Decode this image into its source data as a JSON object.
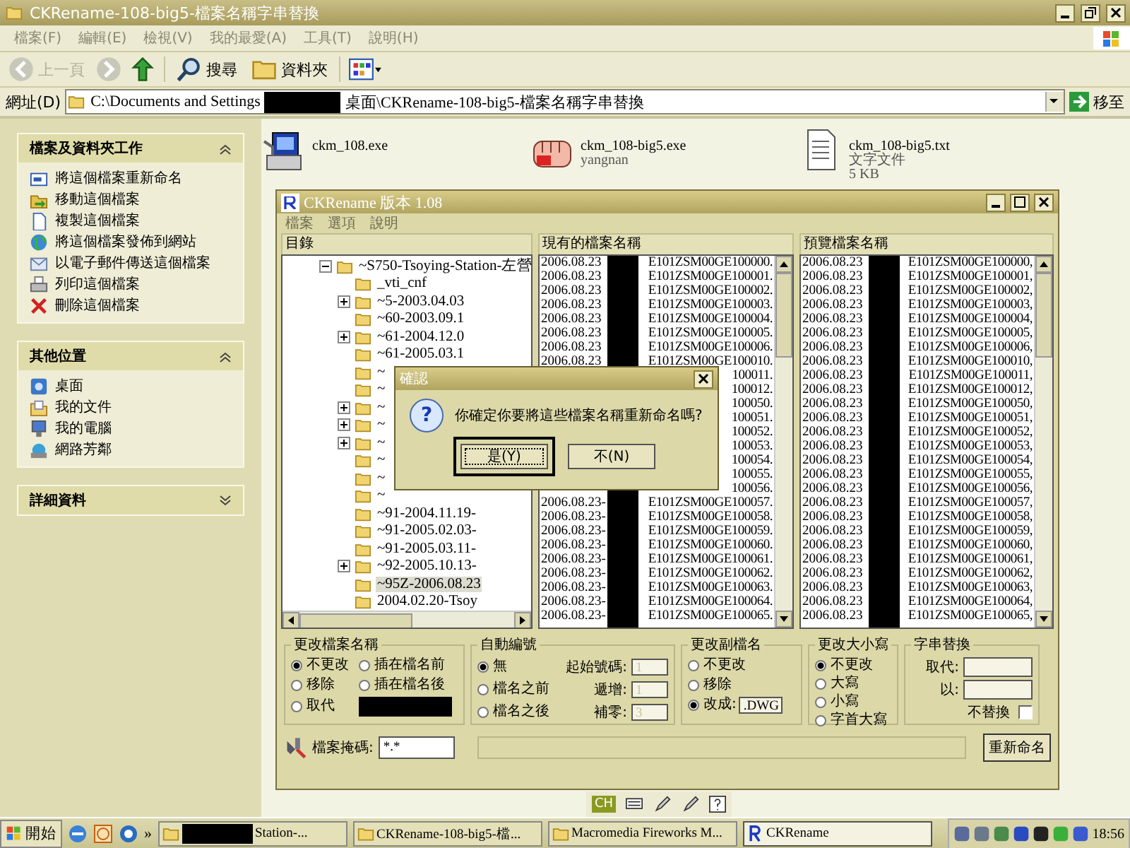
{
  "window": {
    "title": "CKRename-108-big5-檔案名稱字串替換"
  },
  "menu": [
    "檔案(F)",
    "編輯(E)",
    "檢視(V)",
    "我的最愛(A)",
    "工具(T)",
    "說明(H)"
  ],
  "toolbar": {
    "back": "上一頁",
    "search": "搜尋",
    "folders": "資料夾"
  },
  "address": {
    "label": "網址(D)",
    "path_start": "C:\\Documents and Settings",
    "path_end": "桌面\\CKRename-108-big5-檔案名稱字串替換",
    "go": "移至"
  },
  "sidebar": [
    {
      "title": "檔案及資料夾工作",
      "expanded": true,
      "items": [
        "將這個檔案重新命名",
        "移動這個檔案",
        "複製這個檔案",
        "將這個檔案發佈到網站",
        "以電子郵件傳送這個檔案",
        "列印這個檔案",
        "刪除這個檔案"
      ]
    },
    {
      "title": "其他位置",
      "expanded": true,
      "items": [
        "桌面",
        "我的文件",
        "我的電腦",
        "網路芳鄰"
      ]
    },
    {
      "title": "詳細資料",
      "expanded": false
    }
  ],
  "files": [
    {
      "name": "ckm_108.exe"
    },
    {
      "name": "ckm_108-big5.exe",
      "details": [
        "yangnan"
      ]
    },
    {
      "name": "ckm_108-big5.txt",
      "details": [
        "文字文件",
        "5 KB"
      ]
    }
  ],
  "app": {
    "title": "CKRename 版本 1.08",
    "menu": [
      "檔案",
      "選項",
      "說明"
    ],
    "tree": {
      "heading": "目錄",
      "items": [
        {
          "label": "~S750-Tsoying-Station-左營",
          "expander": true,
          "expanded": true,
          "selected": false,
          "children": [
            {
              "label": "_vti_cnf",
              "expander": false,
              "selected": false
            },
            {
              "label": "~5-2003.04.03",
              "expander": true,
              "selected": false
            },
            {
              "label": "~60-2003.09.1",
              "expander": false,
              "selected": false
            },
            {
              "label": "~61-2004.12.0",
              "expander": true,
              "selected": false
            },
            {
              "label": "~61-2005.03.1",
              "expander": false,
              "selected": false
            },
            {
              "label": "~",
              "expander": false,
              "selected": false
            },
            {
              "label": "~",
              "expander": false,
              "selected": false
            },
            {
              "label": "~",
              "expander": true,
              "selected": false
            },
            {
              "label": "~",
              "expander": true,
              "selected": false
            },
            {
              "label": "~",
              "expander": true,
              "selected": false
            },
            {
              "label": "~",
              "expander": false,
              "selected": false
            },
            {
              "label": "~",
              "expander": false,
              "selected": false
            },
            {
              "label": "~",
              "expander": false,
              "selected": false
            },
            {
              "label": "~91-2004.11.19-",
              "expander": false,
              "selected": false
            },
            {
              "label": "~91-2005.02.03-",
              "expander": false,
              "selected": false
            },
            {
              "label": "~91-2005.03.11-",
              "expander": false,
              "selected": false
            },
            {
              "label": "~92-2005.10.13-",
              "expander": true,
              "selected": false
            },
            {
              "label": "~95Z-2006.08.23",
              "expander": false,
              "selected": true
            },
            {
              "label": "2004.02.20-Tsoy",
              "expander": false,
              "selected": false
            }
          ]
        }
      ]
    },
    "current": {
      "heading": "現有的檔案名稱",
      "rows": [
        {
          "prefix": "2006.08.23",
          "suffix": "E101ZSM00GE100000."
        },
        {
          "prefix": "2006.08.23",
          "suffix": "E101ZSM00GE100001."
        },
        {
          "prefix": "2006.08.23",
          "suffix": "E101ZSM00GE100002."
        },
        {
          "prefix": "2006.08.23",
          "suffix": "E101ZSM00GE100003."
        },
        {
          "prefix": "2006.08.23",
          "suffix": "E101ZSM00GE100004."
        },
        {
          "prefix": "2006.08.23",
          "suffix": "E101ZSM00GE100005."
        },
        {
          "prefix": "2006.08.23",
          "suffix": "E101ZSM00GE100006."
        },
        {
          "prefix": "2006.08.23",
          "suffix": "E101ZSM00GE100010."
        },
        {
          "suffix": "100011."
        },
        {
          "suffix": "100012."
        },
        {
          "suffix": "100050."
        },
        {
          "suffix": "100051."
        },
        {
          "suffix": "100052."
        },
        {
          "suffix": "100053."
        },
        {
          "suffix": "100054."
        },
        {
          "suffix": "100055."
        },
        {
          "suffix": "100056."
        },
        {
          "prefix": "2006.08.23-",
          "suffix": "E101ZSM00GE100057."
        },
        {
          "prefix": "2006.08.23-",
          "suffix": "E101ZSM00GE100058."
        },
        {
          "prefix": "2006.08.23-",
          "suffix": "E101ZSM00GE100059."
        },
        {
          "prefix": "2006.08.23-",
          "suffix": "E101ZSM00GE100060."
        },
        {
          "prefix": "2006.08.23-",
          "suffix": "E101ZSM00GE100061."
        },
        {
          "prefix": "2006.08.23-",
          "suffix": "E101ZSM00GE100062."
        },
        {
          "prefix": "2006.08.23-",
          "suffix": "E101ZSM00GE100063."
        },
        {
          "prefix": "2006.08.23-",
          "suffix": "E101ZSM00GE100064."
        },
        {
          "prefix": "2006.08.23-",
          "suffix": "E101ZSM00GE100065."
        }
      ]
    },
    "preview": {
      "heading": "預覽檔案名稱",
      "rows": [
        {
          "prefix": "2006.08.23",
          "suffix": "E101ZSM00GE100000,"
        },
        {
          "prefix": "2006.08.23",
          "suffix": "E101ZSM00GE100001,"
        },
        {
          "prefix": "2006.08.23",
          "suffix": "E101ZSM00GE100002,"
        },
        {
          "prefix": "2006.08.23",
          "suffix": "E101ZSM00GE100003,"
        },
        {
          "prefix": "2006.08.23",
          "suffix": "E101ZSM00GE100004,"
        },
        {
          "prefix": "2006.08.23",
          "suffix": "E101ZSM00GE100005,"
        },
        {
          "prefix": "2006.08.23",
          "suffix": "E101ZSM00GE100006,"
        },
        {
          "prefix": "2006.08.23",
          "suffix": "E101ZSM00GE100010,"
        },
        {
          "prefix": "2006.08.23",
          "suffix": "E101ZSM00GE100011,"
        },
        {
          "prefix": "2006.08.23",
          "suffix": "E101ZSM00GE100012,"
        },
        {
          "prefix": "2006.08.23",
          "suffix": "E101ZSM00GE100050,"
        },
        {
          "prefix": "2006.08.23",
          "suffix": "E101ZSM00GE100051,"
        },
        {
          "prefix": "2006.08.23",
          "suffix": "E101ZSM00GE100052,"
        },
        {
          "prefix": "2006.08.23",
          "suffix": "E101ZSM00GE100053,"
        },
        {
          "prefix": "2006.08.23",
          "suffix": "E101ZSM00GE100054,"
        },
        {
          "prefix": "2006.08.23",
          "suffix": "E101ZSM00GE100055,"
        },
        {
          "prefix": "2006.08.23",
          "suffix": "E101ZSM00GE100056,"
        },
        {
          "prefix": "2006.08.23",
          "suffix": "E101ZSM00GE100057,"
        },
        {
          "prefix": "2006.08.23",
          "suffix": "E101ZSM00GE100058,"
        },
        {
          "prefix": "2006.08.23",
          "suffix": "E101ZSM00GE100059,"
        },
        {
          "prefix": "2006.08.23",
          "suffix": "E101ZSM00GE100060,"
        },
        {
          "prefix": "2006.08.23",
          "suffix": "E101ZSM00GE100061,"
        },
        {
          "prefix": "2006.08.23",
          "suffix": "E101ZSM00GE100062,"
        },
        {
          "prefix": "2006.08.23",
          "suffix": "E101ZSM00GE100063,"
        },
        {
          "prefix": "2006.08.23",
          "suffix": "E101ZSM00GE100064,"
        },
        {
          "prefix": "2006.08.23",
          "suffix": "E101ZSM00GE100065,"
        }
      ]
    },
    "rename_group": {
      "title": "更改檔案名稱",
      "options": [
        {
          "label": "不更改",
          "selected": true
        },
        {
          "label": "插在檔名前",
          "selected": false
        },
        {
          "label": "移除",
          "selected": false
        },
        {
          "label": "插在檔名後",
          "selected": false
        },
        {
          "label": "取代",
          "selected": false
        }
      ]
    },
    "numbering": {
      "title": "自動編號",
      "options": [
        {
          "label": "無",
          "selected": true
        },
        {
          "label": "檔名之前",
          "selected": false
        },
        {
          "label": "檔名之後",
          "selected": false
        }
      ],
      "fields": [
        {
          "label": "起始號碼:",
          "value": "1"
        },
        {
          "label": "遞增:",
          "value": "1"
        },
        {
          "label": "補零:",
          "value": "3"
        }
      ]
    },
    "extension": {
      "title": "更改副檔名",
      "options": [
        {
          "label": "不更改",
          "selected": false
        },
        {
          "label": "移除",
          "selected": false
        },
        {
          "label": "改成:",
          "selected": true
        }
      ],
      "value": ".DWG"
    },
    "case": {
      "title": "更改大小寫",
      "options": [
        {
          "label": "不更改",
          "selected": true
        },
        {
          "label": "大寫",
          "selected": false
        },
        {
          "label": "小寫",
          "selected": false
        },
        {
          "label": "字首大寫",
          "selected": false
        }
      ]
    },
    "replace": {
      "title": "字串替換",
      "fields": [
        {
          "label": "取代:"
        },
        {
          "label": "以:"
        }
      ],
      "no_replace": {
        "label": "不替換",
        "checked": false
      }
    },
    "mask": {
      "label": "檔案掩碼:",
      "value": "*.*"
    },
    "progress": {
      "level": 0
    },
    "rename_button": "重新命名"
  },
  "dialog": {
    "title": "確認",
    "icon": "?",
    "message": "你確定你要將這些檔案名稱重新命名嗎?",
    "buttons": [
      {
        "label": "是(Y)",
        "focused": true
      },
      {
        "label": "不(N)",
        "focused": false
      }
    ]
  },
  "language_bar": {
    "label": "CH"
  },
  "taskbar": {
    "start": "開始",
    "more": "»",
    "tasks": [
      {
        "label": "Station-...",
        "redacted": true,
        "selected": false
      },
      {
        "label": "CKRename-108-big5-檔...",
        "redacted": false,
        "selected": false
      },
      {
        "label": "Macromedia Fireworks M...",
        "redacted": false,
        "selected": false
      },
      {
        "label": "CKRename",
        "redacted": false,
        "selected": true
      }
    ],
    "clock": "18:56"
  }
}
